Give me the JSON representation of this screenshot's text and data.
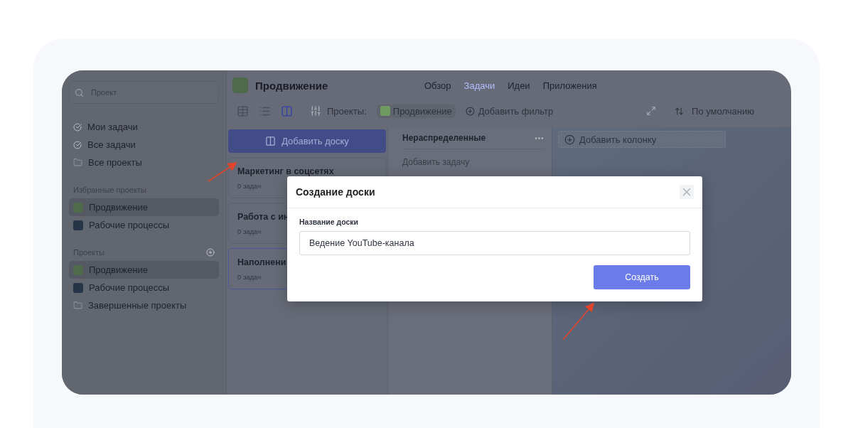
{
  "sidebar": {
    "search": {
      "placeholder": "Проект"
    },
    "nav": [
      {
        "label": "Мои задачи",
        "kind": "check"
      },
      {
        "label": "Все задачи",
        "kind": "check"
      },
      {
        "label": "Все проекты",
        "kind": "folder"
      }
    ],
    "favorites": {
      "title": "Избранные проекты",
      "items": [
        {
          "label": "Продвижение",
          "kind": "project",
          "color": "#4f6a4a",
          "selected": true
        },
        {
          "label": "Рабочие процессы",
          "kind": "project",
          "color": "#253447",
          "selected": false
        }
      ]
    },
    "projects": {
      "title": "Проекты",
      "items": [
        {
          "label": "Продвижение",
          "kind": "project",
          "color": "#4f6a4a",
          "selected": true
        },
        {
          "label": "Рабочие процессы",
          "kind": "project",
          "color": "#253447",
          "selected": false
        },
        {
          "label": "Завершенные проекты",
          "kind": "folder",
          "selected": false
        }
      ]
    }
  },
  "header": {
    "title": "Продвижение",
    "tabs": [
      {
        "label": "Обзор",
        "selected": false
      },
      {
        "label": "Задачи",
        "selected": true
      },
      {
        "label": "Идеи",
        "selected": false
      },
      {
        "label": "Приложения",
        "selected": false
      }
    ]
  },
  "toolbar": {
    "views": [
      {
        "kind": "table",
        "selected": false
      },
      {
        "kind": "list",
        "selected": false
      },
      {
        "kind": "board",
        "selected": true
      }
    ],
    "filter_label": "Проекты:",
    "filter_chip": "Продвижение",
    "add_filter": "Добавить фильтр",
    "sort": "По умолчанию"
  },
  "boards": {
    "add_button": "Добавить доску",
    "items": [
      {
        "title": "Маркетинг в соцсетях",
        "count": "0 задач",
        "selected": false
      },
      {
        "title": "Работа с ин",
        "count": "0 задач",
        "selected": false
      },
      {
        "title": "Наполнени",
        "count": "0 задач",
        "selected": true
      }
    ]
  },
  "column": {
    "title": "Нераспределенные",
    "add_task": "Добавить задачу"
  },
  "add_column": "Добавить колонку",
  "dialog": {
    "title": "Создание доски",
    "field_label": "Название доски",
    "value": "Ведение YouTube-канала",
    "submit": "Создать"
  }
}
